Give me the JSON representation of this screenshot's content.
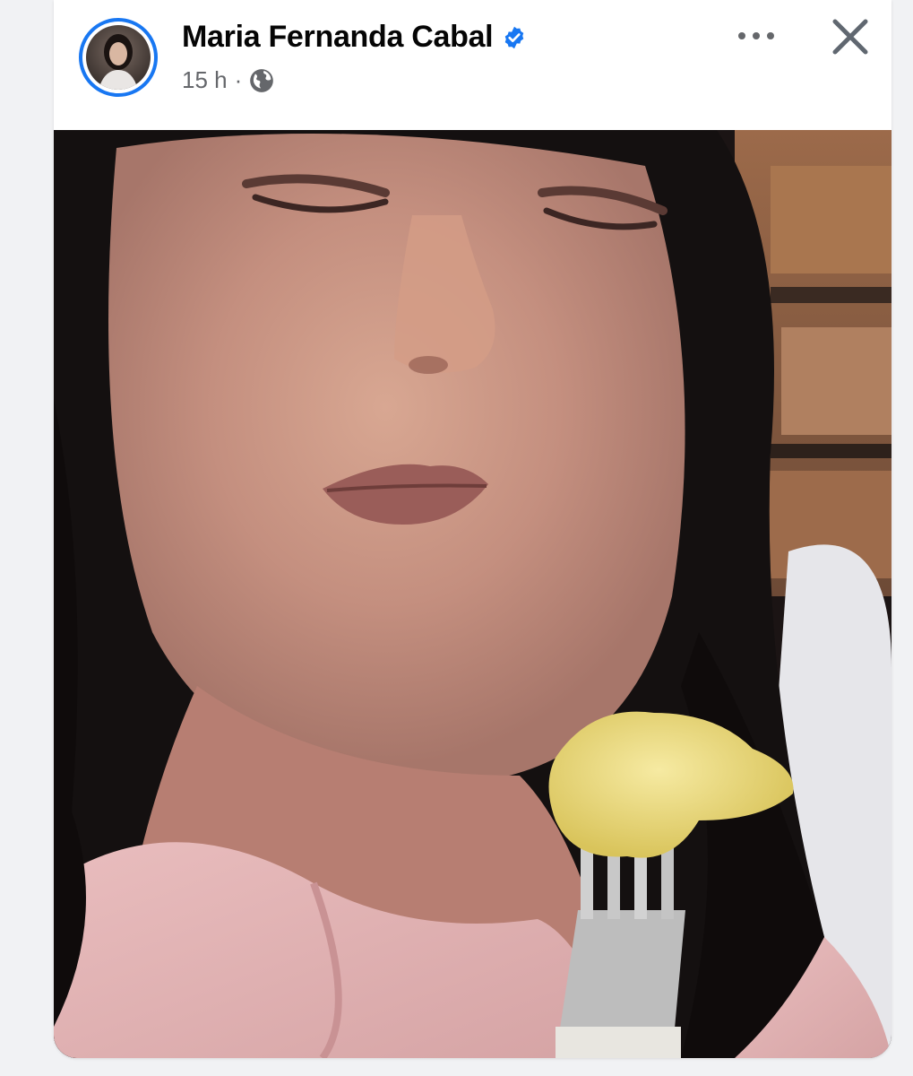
{
  "post": {
    "author_name": "Maria Fernanda Cabal",
    "verified_icon": "verified-badge-icon",
    "timestamp": "15 h",
    "separator": "·",
    "privacy_icon": "globe-icon",
    "more_icon": "more-options-icon",
    "close_icon": "close-icon"
  },
  "colors": {
    "accent": "#1877f2",
    "name_text": "#050505",
    "meta_text": "#65676b"
  }
}
